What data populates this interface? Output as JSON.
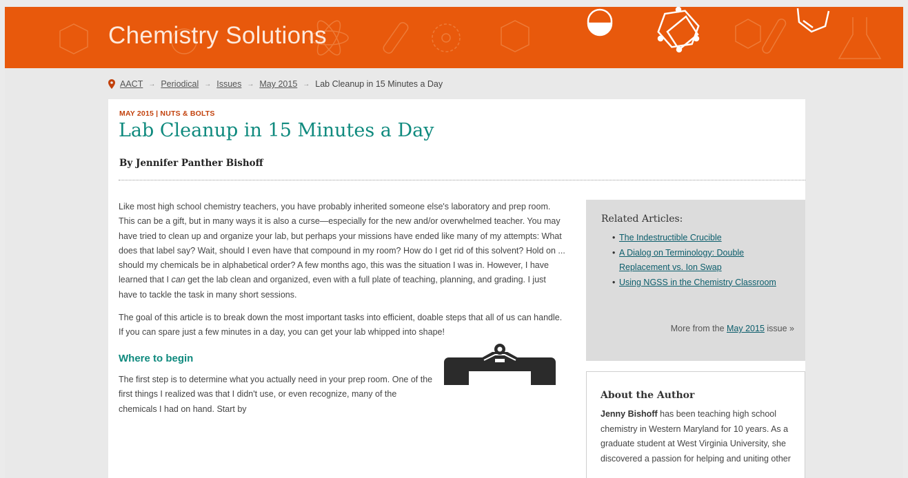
{
  "banner": {
    "site_title": "Chemistry Solutions",
    "color": "#e8590c"
  },
  "breadcrumb": {
    "items": [
      "AACT",
      "Periodical",
      "Issues",
      "May 2015"
    ],
    "current": "Lab Cleanup in 15 Minutes a Day",
    "separator": "→"
  },
  "article": {
    "kicker": "MAY 2015 | NUTS & BOLTS",
    "title": "Lab Cleanup in 15 Minutes a Day",
    "byline": "By Jennifer Panther Bishoff",
    "paragraph1_part1": "Like most high school chemistry teachers, you have probably inherited someone else's laboratory and prep room. This can be a gift, but in many ways it is also a curse—especially for the new and/or overwhelmed teacher. You may have tried to clean up and organize your lab, but perhaps your missions have ended like many of my attempts: What does that label say? Wait, should I even have that compound in my room? How do I get rid of this solvent? Hold on ... should my chemicals be in alphabetical order? A few months ago, this was the situation I was in. However, I have learned that I ",
    "paragraph1_emphasis": "can",
    "paragraph1_part2": " get the lab clean and organized, even with a full plate of teaching, planning, and grading. I just have to tackle the task in many short sessions.",
    "paragraph2": "The goal of this article is to break down the most important tasks into efficient, doable steps that all of us can handle. If you can spare just a few minutes in a day, you can get your lab whipped into shape!",
    "section_heading": "Where to begin",
    "paragraph3": "The first step is to determine what you actually need in your prep room. One of the first things I realized was that I didn't use, or even recognize, many of the chemicals I had on hand. Start by"
  },
  "related": {
    "heading": "Related Articles:",
    "links": [
      "The Indestructible Crucible",
      "A Dialog on Terminology: Double Replacement vs. Ion Swap",
      "Using NGSS in the Chemistry Classroom"
    ],
    "more_prefix": "More from the ",
    "more_link": "May 2015",
    "more_suffix": " issue »"
  },
  "author": {
    "heading": "About the Author",
    "name": "Jenny Bishoff",
    "bio": " has been teaching high school chemistry in Western Maryland for 10 years. As a graduate student at West Virginia University, she discovered a passion for helping and uniting other"
  },
  "colors": {
    "accent": "#0f8a7e",
    "kicker": "#c2410c",
    "link": "#0b5d6b",
    "sidebar_bg": "#dcdcdc"
  }
}
